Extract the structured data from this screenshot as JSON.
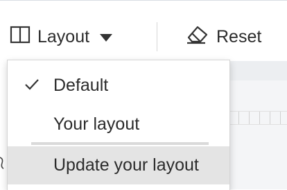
{
  "toolbar": {
    "layout_label": "Layout",
    "reset_label": "Reset"
  },
  "menu": {
    "items": [
      {
        "label": "Default",
        "selected": true
      },
      {
        "label": "Your layout",
        "selected": false
      },
      {
        "label": "Update your layout",
        "selected": false,
        "highlighted": true
      }
    ]
  },
  "icons": {
    "layout": "columns-icon",
    "dropdown": "caret-down-icon",
    "reset": "eraser-icon",
    "selected": "checkmark-icon"
  },
  "colors": {
    "text": "#2b2b2b",
    "highlight": "#e4e4e4",
    "border": "#d4d4d4"
  }
}
